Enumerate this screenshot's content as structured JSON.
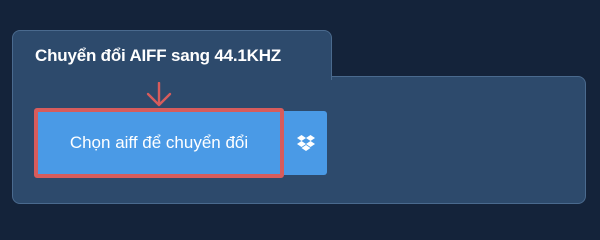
{
  "converter": {
    "title": "Chuyển đổi AIFF sang 44.1KHZ",
    "choose_button_label": "Chọn aiff để chuyển đổi",
    "dropbox_icon": "dropbox-icon",
    "pointer_icon": "arrow-down-icon"
  },
  "colors": {
    "background": "#14233a",
    "panel": "#2d4a6c",
    "button": "#4a9ae6",
    "highlight": "#d75c5c"
  }
}
